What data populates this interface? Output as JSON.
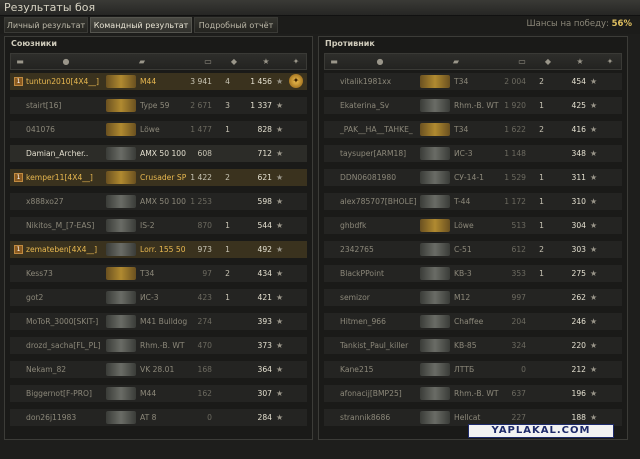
{
  "window": {
    "title": "Результаты боя"
  },
  "tabs": [
    "Личный результат",
    "Командный результат",
    "Подробный отчёт"
  ],
  "active_tab": 1,
  "chance": {
    "label": "Шансы на победу:",
    "value": "56%"
  },
  "allies": {
    "title": "Союзники",
    "rows": [
      {
        "platoon": "1",
        "name": "tuntun2010[4X4__]",
        "tank": "M44",
        "dmg": "3 941",
        "kills": "4",
        "xp": "1 456",
        "state": "me",
        "tank_color": "gold",
        "medal": true
      },
      {
        "platoon": "",
        "name": "stairt[16]",
        "tank": "Type 59",
        "dmg": "2 671",
        "kills": "3",
        "xp": "1 337",
        "state": "dead",
        "tank_color": "gold"
      },
      {
        "platoon": "",
        "name": "041076",
        "tank": "Löwe",
        "dmg": "1 477",
        "kills": "1",
        "xp": "828",
        "state": "dead",
        "tank_color": "gold"
      },
      {
        "platoon": "",
        "name": "Damian_Archer..",
        "tank": "AMX 50 100",
        "dmg": "608",
        "kills": "",
        "xp": "712",
        "state": "alive",
        "tank_color": "grey"
      },
      {
        "platoon": "1",
        "name": "kemper11[4X4__]",
        "tank": "Crusader SP",
        "dmg": "1 422",
        "kills": "2",
        "xp": "621",
        "state": "me",
        "tank_color": "gold"
      },
      {
        "platoon": "",
        "name": "x888xo27",
        "tank": "AMX 50 100",
        "dmg": "1 253",
        "kills": "",
        "xp": "598",
        "state": "dead",
        "tank_color": "grey"
      },
      {
        "platoon": "",
        "name": "Nikitos_M_[7-EAS]",
        "tank": "IS-2",
        "dmg": "870",
        "kills": "1",
        "xp": "544",
        "state": "dead",
        "tank_color": "grey"
      },
      {
        "platoon": "1",
        "name": "zemateben[4X4__]",
        "tank": "Lorr. 155 50",
        "dmg": "973",
        "kills": "1",
        "xp": "492",
        "state": "me",
        "tank_color": "grey"
      },
      {
        "platoon": "",
        "name": "Kess73",
        "tank": "T34",
        "dmg": "97",
        "kills": "2",
        "xp": "434",
        "state": "dead",
        "tank_color": "gold"
      },
      {
        "platoon": "",
        "name": "got2",
        "tank": "ИС-3",
        "dmg": "423",
        "kills": "1",
        "xp": "421",
        "state": "dead",
        "tank_color": "grey"
      },
      {
        "platoon": "",
        "name": "MoToR_3000[SKIT-]",
        "tank": "M41 Bulldog",
        "dmg": "274",
        "kills": "",
        "xp": "393",
        "state": "dead",
        "tank_color": "grey"
      },
      {
        "platoon": "",
        "name": "drozd_sacha[FL_PL]",
        "tank": "Rhm.-B. WT",
        "dmg": "470",
        "kills": "",
        "xp": "373",
        "state": "dead",
        "tank_color": "grey"
      },
      {
        "platoon": "",
        "name": "Nekam_82",
        "tank": "VK 28.01",
        "dmg": "168",
        "kills": "",
        "xp": "364",
        "state": "dead",
        "tank_color": "grey"
      },
      {
        "platoon": "",
        "name": "Biggernot[F-PRO]",
        "tank": "M44",
        "dmg": "162",
        "kills": "",
        "xp": "307",
        "state": "dead",
        "tank_color": "grey"
      },
      {
        "platoon": "",
        "name": "don26j11983",
        "tank": "AT 8",
        "dmg": "0",
        "kills": "",
        "xp": "284",
        "state": "dead",
        "tank_color": "grey"
      }
    ]
  },
  "enemies": {
    "title": "Противник",
    "rows": [
      {
        "name": "vitalik1981xx",
        "tank": "T34",
        "dmg": "2 004",
        "kills": "2",
        "xp": "454",
        "state": "dead",
        "tank_color": "gold"
      },
      {
        "name": "Ekaterina_Sv",
        "tank": "Rhm.-B. WT",
        "dmg": "1 920",
        "kills": "1",
        "xp": "425",
        "state": "dead",
        "tank_color": "grey"
      },
      {
        "name": "_PAK__HA__TAHKE_",
        "tank": "T34",
        "dmg": "1 622",
        "kills": "2",
        "xp": "416",
        "state": "dead",
        "tank_color": "gold"
      },
      {
        "name": "taysuper[ARM18]",
        "tank": "ИС-3",
        "dmg": "1 148",
        "kills": "",
        "xp": "348",
        "state": "dead",
        "tank_color": "grey"
      },
      {
        "name": "DDN06081980",
        "tank": "СУ-14-1",
        "dmg": "1 529",
        "kills": "1",
        "xp": "311",
        "state": "dead",
        "tank_color": "grey"
      },
      {
        "name": "alex785707[BHOLE]",
        "tank": "T-44",
        "dmg": "1 172",
        "kills": "1",
        "xp": "310",
        "state": "dead",
        "tank_color": "grey"
      },
      {
        "name": "ghbdfk",
        "tank": "Löwe",
        "dmg": "513",
        "kills": "1",
        "xp": "304",
        "state": "dead",
        "tank_color": "gold"
      },
      {
        "name": "2342765",
        "tank": "C-51",
        "dmg": "612",
        "kills": "2",
        "xp": "303",
        "state": "dead",
        "tank_color": "grey"
      },
      {
        "name": "BlackPPoint",
        "tank": "KB-3",
        "dmg": "353",
        "kills": "1",
        "xp": "275",
        "state": "dead",
        "tank_color": "grey"
      },
      {
        "name": "semizor",
        "tank": "M12",
        "dmg": "997",
        "kills": "",
        "xp": "262",
        "state": "dead",
        "tank_color": "grey"
      },
      {
        "name": "Hitmen_966",
        "tank": "Chaffee",
        "dmg": "204",
        "kills": "",
        "xp": "246",
        "state": "dead",
        "tank_color": "grey"
      },
      {
        "name": "Tankist_Paul_killer",
        "tank": "KB-85",
        "dmg": "324",
        "kills": "",
        "xp": "220",
        "state": "dead",
        "tank_color": "grey"
      },
      {
        "name": "Kane215",
        "tank": "ЛТТБ",
        "dmg": "0",
        "kills": "",
        "xp": "212",
        "state": "dead",
        "tank_color": "grey"
      },
      {
        "name": "afonacij[BMP25]",
        "tank": "Rhm.-B. WT",
        "dmg": "637",
        "kills": "",
        "xp": "196",
        "state": "dead",
        "tank_color": "grey"
      },
      {
        "name": "strannik8686",
        "tank": "Hellcat",
        "dmg": "227",
        "kills": "",
        "xp": "188",
        "state": "dead",
        "tank_color": "grey"
      }
    ]
  },
  "watermark": "YAPLAKAL.COM"
}
